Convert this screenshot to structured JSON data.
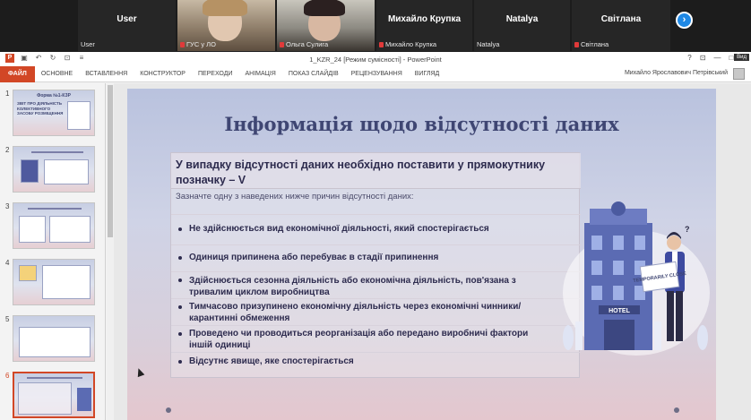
{
  "conference": {
    "tiles": [
      {
        "name": "User",
        "caption": "User"
      },
      {
        "caption": "ГУС у ЛО"
      },
      {
        "caption": "Ольга Сулига"
      },
      {
        "name": "Михайло Крупка",
        "caption": "Михайло Крупка"
      },
      {
        "name": "Natalya",
        "caption": "Natalya"
      },
      {
        "name": "Світлана",
        "caption": "Світлана"
      }
    ],
    "next_icon": "chevron-right-icon",
    "mic_muted_color": "#e03a3a"
  },
  "powerpoint": {
    "window_title": "1_KZR_24 [Режим сумісності] - PowerPoint",
    "tooltip": "Вид",
    "accent": "#d24726",
    "tabs": [
      "ФАЙЛ",
      "ОСНОВНЕ",
      "ВСТАВЛЕННЯ",
      "КОНСТРУКТОР",
      "ПЕРЕХОДИ",
      "АНІМАЦІЯ",
      "ПОКАЗ СЛАЙДІВ",
      "РЕЦЕНЗУВАННЯ",
      "ВИГЛЯД"
    ],
    "user_name": "Михайло Ярославович Петрівський",
    "window_controls": [
      "?",
      "⊡",
      "—",
      "□",
      "✕"
    ]
  },
  "thumbnails": [
    {
      "num": "1",
      "title": "Форма №1-КЗР",
      "text": "ЗВІТ ПРО ДІЯЛЬНІСТЬ КОЛЕКТИВНОГО ЗАСОБУ РОЗМІЩЕННЯ"
    },
    {
      "num": "2"
    },
    {
      "num": "3"
    },
    {
      "num": "4"
    },
    {
      "num": "5"
    },
    {
      "num": "6",
      "selected": true
    }
  ],
  "slide": {
    "title": "Інформація щодо відсутності даних",
    "heading": "У випадку відсутності даних необхідно поставити у прямокутнику позначку – V",
    "subheading": "Зазначте одну з наведених нижче причин відсутності даних:",
    "items": [
      "Не здійснюється вид економічної діяльності, який спостерігається",
      "Одиниця припинена або перебуває в стадії припинення",
      "Здійснюється сезонна діяльність або економічна діяльність, пов'язана з тривалим циклом виробництва",
      "Тимчасово призупинено економічну діяльність через економічні чинники/карантинні обмеження",
      "Проведено чи проводиться реорганізація або передано виробничі фактори іншій одиниці",
      "Відсутнє явище, яке спостерігається"
    ],
    "illustration": {
      "sign": "TEMPORARILY CLOSE",
      "hotel_sign": "HOTEL",
      "building_color": "#5b6bb3"
    }
  }
}
